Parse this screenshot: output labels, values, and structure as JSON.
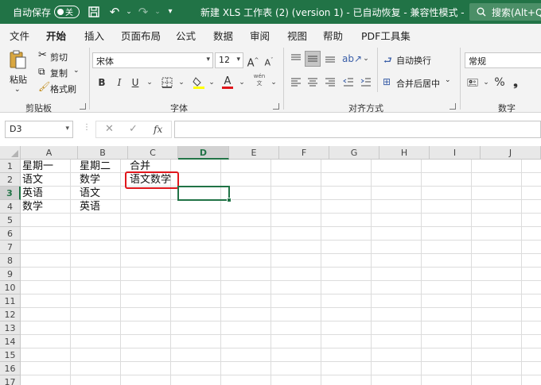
{
  "titlebar": {
    "autosave_label": "自动保存",
    "autosave_state": "关",
    "doc_title": "新建 XLS 工作表 (2) (version 1)  -  已自动恢复  -  兼容性模式  -",
    "search_placeholder": "搜索(Alt+Q)",
    "accent": "#217346"
  },
  "tabs": [
    "文件",
    "开始",
    "插入",
    "页面布局",
    "公式",
    "数据",
    "审阅",
    "视图",
    "帮助",
    "PDF工具集"
  ],
  "active_tab": "开始",
  "ribbon": {
    "clipboard": {
      "paste_label": "粘贴",
      "cut_label": "剪切",
      "copy_label": "复制",
      "format_painter_label": "格式刷",
      "group_label": "剪贴板"
    },
    "font": {
      "font_name": "宋体",
      "font_size": "12",
      "bold": "B",
      "italic": "I",
      "underline": "U",
      "wen": "wén\n文",
      "group_label": "字体"
    },
    "alignment": {
      "wrap_text_label": "自动换行",
      "merge_center_label": "合并后居中",
      "group_label": "对齐方式"
    },
    "number": {
      "format": "常规",
      "group_label": "数字"
    }
  },
  "formula_bar": {
    "name_box": "D3",
    "cancel": "✕",
    "enter": "✓",
    "fx": "fx",
    "formula": ""
  },
  "sheet": {
    "columns": [
      "A",
      "B",
      "C",
      "D",
      "E",
      "F",
      "G",
      "H",
      "I",
      "J"
    ],
    "rows": [
      "1",
      "2",
      "3",
      "4",
      "5",
      "6",
      "7",
      "8",
      "9",
      "10",
      "11",
      "12",
      "13",
      "14",
      "15",
      "16",
      "17"
    ],
    "active_cell": "D3",
    "cells": {
      "A1": "星期一",
      "B1": "星期二",
      "C1": "合并",
      "A2": "语文",
      "B2": "数学",
      "C2": "语文数学",
      "A3": "英语",
      "B3": "语文",
      "A4": "数学",
      "B4": "英语"
    },
    "highlight_cell": "C2",
    "highlight_color": "#e0161b"
  }
}
